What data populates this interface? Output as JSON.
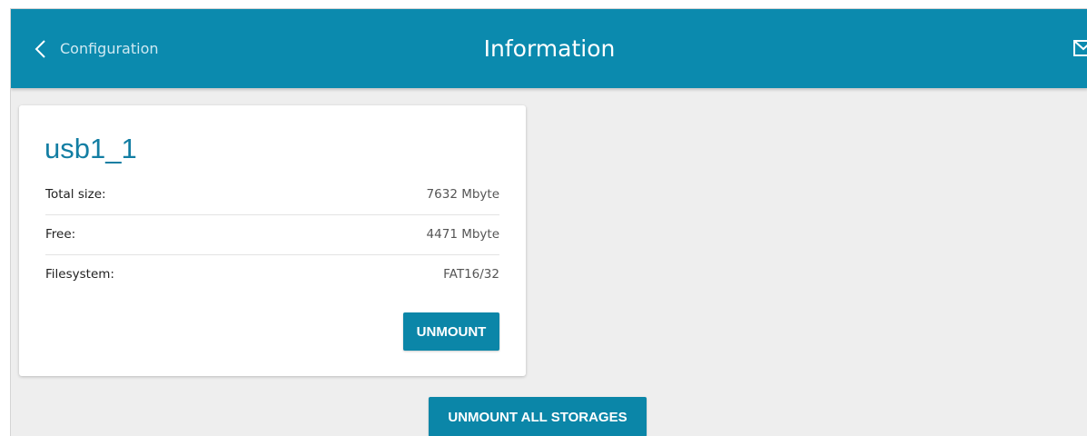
{
  "header": {
    "back_label": "Configuration",
    "title": "Information",
    "icons": [
      "chevron-left-icon",
      "mail-icon"
    ],
    "background_color": "#0b8aae"
  },
  "storage": {
    "name": "usb1_1",
    "rows": [
      {
        "label": "Total size:",
        "value": "7632 Mbyte"
      },
      {
        "label": "Free:",
        "value": "4471 Mbyte"
      },
      {
        "label": "Filesystem:",
        "value": "FAT16/32"
      }
    ],
    "unmount_label": "UNMOUNT"
  },
  "actions": {
    "unmount_all_label": "UNMOUNT ALL STORAGES"
  },
  "colors": {
    "accent": "#0b86a8",
    "title_text": "#137ea3",
    "page_background": "#eeeeee"
  }
}
